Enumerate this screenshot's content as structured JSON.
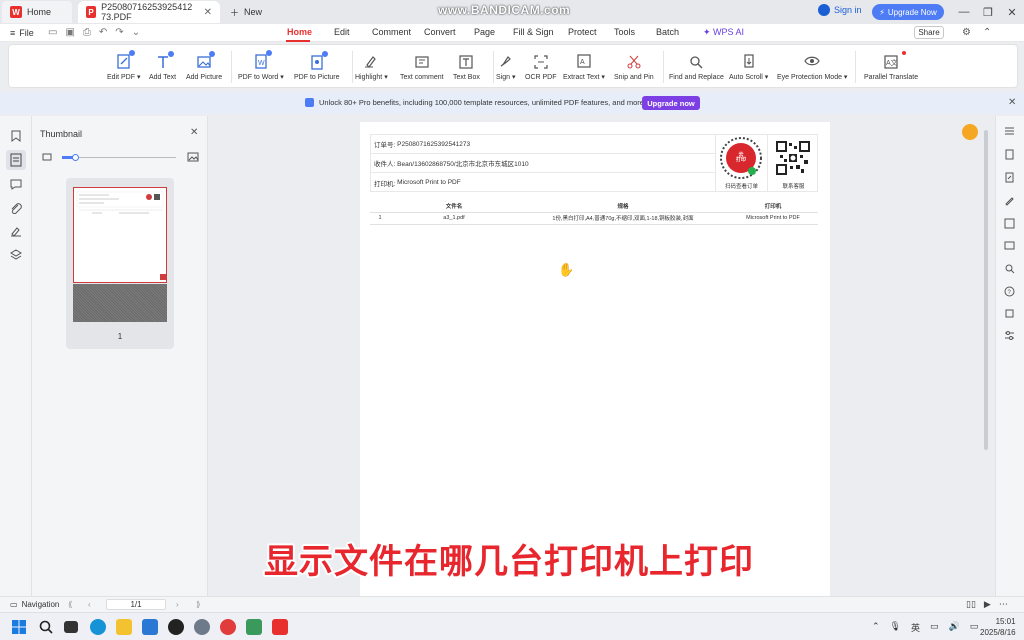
{
  "tabs": {
    "home": "Home",
    "doc": "P25080716253925412​73.PDF",
    "new": "New"
  },
  "watermark": "www.BANDICAM.com",
  "account": {
    "signin": "Sign in",
    "upgrade": "Upgrade Now"
  },
  "menu": {
    "file": "File",
    "items": [
      "Home",
      "Edit",
      "Comment",
      "Convert",
      "Page",
      "Fill & Sign",
      "Protect",
      "Tools",
      "Batch",
      "WPS AI"
    ],
    "active": "Home",
    "share": "Share"
  },
  "ribbon": {
    "edit_pdf": "Edit PDF",
    "add_text": "Add Text",
    "add_picture": "Add Picture",
    "pdf_to_word": "PDF to Word",
    "pdf_to_picture": "PDF to Picture",
    "highlight": "Highlight",
    "text_comment": "Text comment",
    "text_box": "Text Box",
    "sign": "Sign",
    "ocr_pdf": "OCR PDF",
    "extract_text": "Extract Text",
    "snip_and_pin": "Snip and Pin",
    "find_and_replace": "Find and Replace",
    "auto_scroll": "Auto Scroll",
    "eye_protection": "Eye Protection Mode",
    "parallel_translate": "Parallel Translate"
  },
  "banner": {
    "text": "Unlock 80+ Pro benefits, including 100,000 template resources, unlimited PDF features, and more.",
    "button": "Upgrade now"
  },
  "thumbnail": {
    "title": "Thumbnail",
    "page_number": "1",
    "zoom": 0.12
  },
  "document": {
    "order_label": "订单号:",
    "order_value": "P25080716253925412​73",
    "recipient_label": "收件人:",
    "recipient_value": "Bean/13602868750/北京市北京市东城区1010",
    "printer_label": "打印机:",
    "printer_value": "Microsoft Print to PDF",
    "seal_line1": "云",
    "seal_line2": "打印",
    "qr1_label": "扫码查看订单",
    "qr2_label": "联系客服",
    "table": {
      "headers": [
        "",
        "文件名",
        "规格",
        "打印机"
      ],
      "rows": [
        [
          "1",
          "a3_1.pdf",
          "1份,黑白打印,A4,普通70g,不缩印,双面,1-18,铜板胶装,封面",
          "Microsoft Print to PDF"
        ]
      ]
    }
  },
  "subtitle": "显示文件在哪几台打印机上打印",
  "statusbar": {
    "navigation": "Navigation",
    "page": "1/1"
  },
  "taskbar": {
    "ime": "英",
    "time": "15:01",
    "date": "2025/8/16"
  },
  "colors": {
    "accent": "#e8312f",
    "brand_blue": "#4d7cf5",
    "upgrade_purple": "#7b3fe4",
    "subtitle_red": "#e8262d"
  }
}
